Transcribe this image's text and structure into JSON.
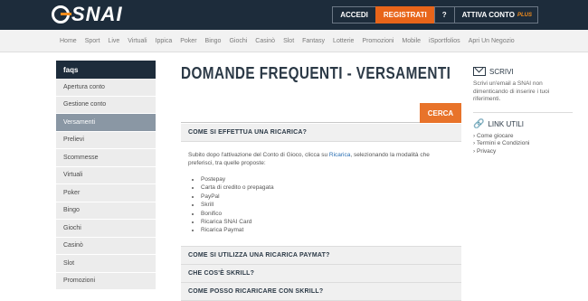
{
  "header": {
    "logo_text": "SNAI",
    "accedi": "ACCEDI",
    "registrati": "REGISTRATI",
    "help": "?",
    "attiva": "ATTIVA CONTO",
    "plus": "PLUS"
  },
  "nav": {
    "items": [
      "Home",
      "Sport",
      "Live",
      "Virtuali",
      "Ippica",
      "Poker",
      "Bingo",
      "Giochi",
      "Casinò",
      "Slot",
      "Fantasy",
      "Lotterie",
      "Promozioni",
      "Mobile",
      "iSportfolios",
      "Apri Un Negozio"
    ]
  },
  "sidebar": {
    "title": "faqs",
    "items": [
      "Apertura conto",
      "Gestione conto",
      "Versamenti",
      "Prelievi",
      "Scommesse",
      "Virtuali",
      "Poker",
      "Bingo",
      "Giochi",
      "Casinò",
      "Slot",
      "Promozioni"
    ],
    "active_index": 2
  },
  "main": {
    "title": "DOMANDE FREQUENTI - VERSAMENTI",
    "search_placeholder": "",
    "search_button": "CERCA",
    "faq": [
      {
        "question": "Come si effettua una ricarica?"
      },
      {
        "question": "Come si utilizza una ricarica Paymat?"
      },
      {
        "question": "Che cos'è Skrill?"
      },
      {
        "question": "Come posso ricaricare con Skrill?"
      }
    ],
    "answer": {
      "text_before": "Subito dopo l'attivazione del Conto di Gioco, clicca su ",
      "link": "Ricarica",
      "text_after": ", selezionando la modalità che preferisci, tra quelle proposte:",
      "methods": [
        "Postepay",
        "Carta di credito o prepagata",
        "PayPal",
        "Skrill",
        "Bonifico",
        "Ricarica SNAI Card",
        "Ricarica Paymat"
      ]
    }
  },
  "right": {
    "scrivi_title": "SCRIVI",
    "scrivi_text": "Scrivi un'email a SNAI non dimenticando di inserire i tuoi riferimenti.",
    "links_title": "LINK UTILI",
    "links": [
      "Come giocare",
      "Termini e Condizioni",
      "Privacy"
    ]
  },
  "colors": {
    "header_bg": "#1d2c3b",
    "accent": "#e8732a",
    "sidebar_active": "#8a97a4",
    "link": "#2a6fb3"
  }
}
